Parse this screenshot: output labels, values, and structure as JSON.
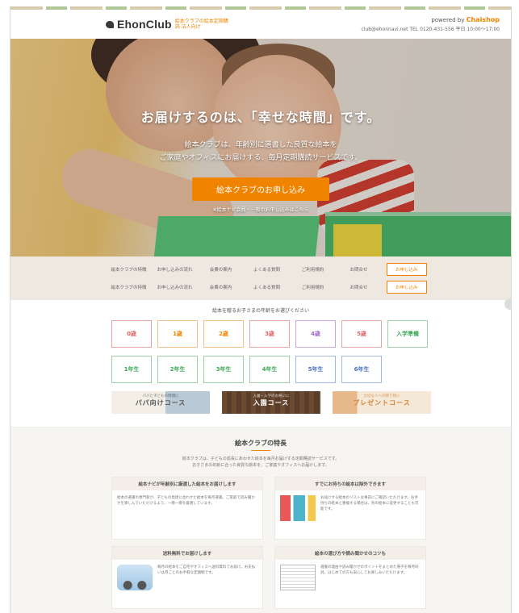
{
  "header": {
    "logo_text": "EhonClub",
    "logo_sub": "絵本クラブの絵本定期購読 法人向け",
    "powered_by": "powered by",
    "powered_brand": "Chaishop",
    "contact": "club@ehonnavi.net  TEL 0120-431-556 平日 10:00〜17:00"
  },
  "hero": {
    "title": "お届けするのは、「幸せな時間」です。",
    "subtitle_line1": "絵本クラブは、年齢別に選書した良質な絵本を",
    "subtitle_line2": "ご家庭やオフィスにお届けする、毎月定期購読サービスです。",
    "cta": "絵本クラブのお申し込み",
    "note": "※絵本ナビ会員・一般のお申し込みはこちら"
  },
  "nav": {
    "rows": [
      [
        "絵本クラブの特徴",
        "お申し込みの流れ",
        "会費の案内",
        "よくある質問",
        "ご利用規約",
        "お問合せ"
      ],
      [
        "絵本クラブの特徴",
        "お申し込みの流れ",
        "会費の案内",
        "よくある質問",
        "ご利用規約",
        "お問合せ"
      ]
    ],
    "cta_label": "お申し込み"
  },
  "ages": {
    "caption": "絵本を贈るお子さまの年齢をお選びください",
    "row1": [
      "0歳",
      "1歳",
      "2歳",
      "3歳",
      "4歳",
      "5歳",
      "入学準備"
    ],
    "row2": [
      "1年生",
      "2年生",
      "3年生",
      "4年生",
      "5年生",
      "6年生"
    ]
  },
  "courses": [
    {
      "small": "パパと子どもの時間に",
      "label": "パパ向けコース"
    },
    {
      "small": "入園・入学のお祝いに",
      "label": "入園コース"
    },
    {
      "small": "大切な人への贈り物に",
      "label": "プレゼントコース"
    }
  ],
  "features": {
    "title": "絵本クラブの特長",
    "intro_line1": "絵本クラブは、子どもの成長にあわせた絵本を毎月お届けする定期購読サービスです。",
    "intro_line2": "お子さまの年齢に合った良質な絵本を、ご家庭やオフィスへお届けします。",
    "cards": [
      {
        "title": "絵本ナビが年齢別に厳選した絵本をお届けします",
        "body": "絵本の選書の専門家が、子どもの発達に合わせた絵本を毎月選書。ご家庭で読み聞かせを楽しんでいただけるよう、一冊一冊を厳選しています。",
        "icon": "books-icon"
      },
      {
        "title": "すでにお持ちの絵本は除外できます",
        "body": "お届けする絵本のリストは事前にご確認いただけます。お手持ちの絵本と重複する場合は、別の絵本に変更することも可能です。",
        "icon": "books-icon"
      },
      {
        "title": "送料無料でお届けします",
        "body": "毎月の絵本をご自宅やオフィスへ送料無料でお届け。お支払いは月ごとのお手軽な定額制です。",
        "icon": "truck-icon"
      },
      {
        "title": "絵本の選び方や読み聞かせのコツも",
        "body": "選書の理由や読み聞かせのポイントをまとめた冊子を毎月同封。はじめての方も安心してお楽しみいただけます。",
        "icon": "paper-icon"
      }
    ]
  }
}
